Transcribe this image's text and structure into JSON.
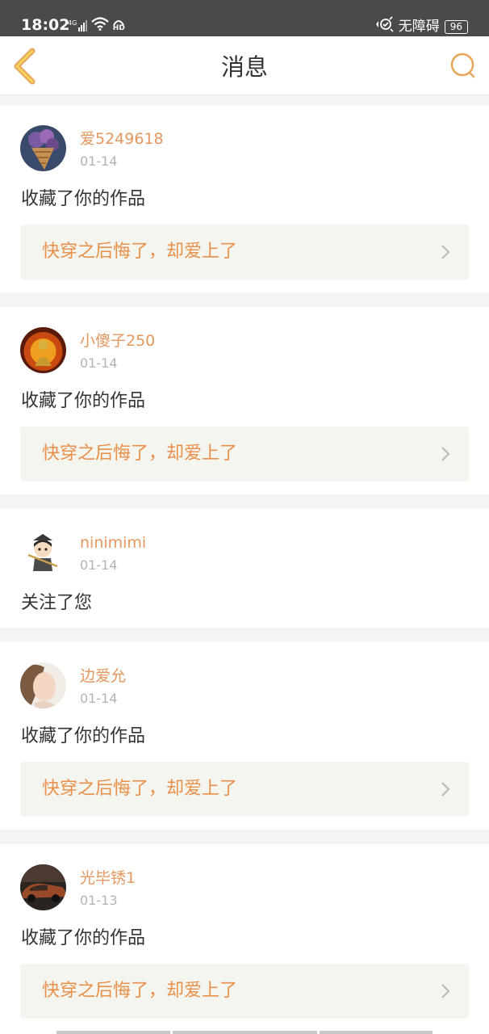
{
  "status_bar": {
    "time": "18:02",
    "signal_label": "4G",
    "hd_label": "HD",
    "accessibility_label": "无障碍",
    "battery": "96"
  },
  "navbar": {
    "title": "消息",
    "accent_color": "#e8a55c"
  },
  "messages": [
    {
      "username": "爱5249618",
      "date": "01-14",
      "action": "收藏了你的作品",
      "work_title": "快穿之后悔了，却爱上了"
    },
    {
      "username": "小傻子250",
      "date": "01-14",
      "action": "收藏了你的作品",
      "work_title": "快穿之后悔了，却爱上了"
    },
    {
      "username": "ninimimi",
      "date": "01-14",
      "action": "关注了您"
    },
    {
      "username": "边爱允",
      "date": "01-14",
      "action": "收藏了你的作品",
      "work_title": "快穿之后悔了，却爱上了"
    },
    {
      "username": "光毕锈1",
      "date": "01-13",
      "action": "收藏了你的作品",
      "work_title": "快穿之后悔了，却爱上了"
    }
  ]
}
